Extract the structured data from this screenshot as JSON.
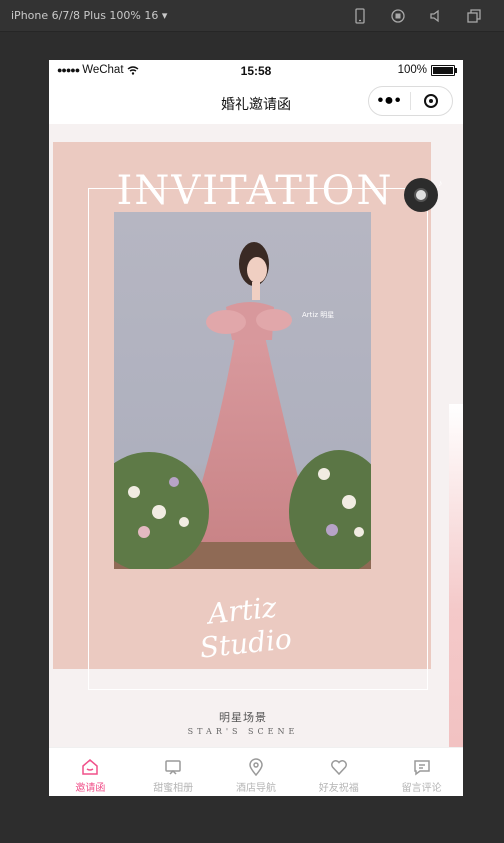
{
  "devtools": {
    "device_label": "iPhone 6/7/8 Plus 100% 16 ▾",
    "icons": [
      "phone-icon",
      "record-icon",
      "speaker-icon",
      "window-icon"
    ]
  },
  "statusbar": {
    "carrier": "WeChat",
    "time": "15:58",
    "battery": "100%"
  },
  "navbar": {
    "title": "婚礼邀请函"
  },
  "invitation": {
    "headline": "INVITATION",
    "signature": "Artiz Studio",
    "scene_cn": "明星场景",
    "scene_en": "STAR'S SCENE"
  },
  "colors": {
    "card_bg": "#ebcac1",
    "tab_active": "#f0508a",
    "tab_inactive": "#b5b5b5"
  },
  "tabs": [
    {
      "label": "邀请函",
      "icon": "home-icon",
      "active": true
    },
    {
      "label": "甜蜜相册",
      "icon": "album-icon",
      "active": false
    },
    {
      "label": "酒店导航",
      "icon": "location-icon",
      "active": false
    },
    {
      "label": "好友祝福",
      "icon": "heart-icon",
      "active": false
    },
    {
      "label": "留言评论",
      "icon": "comment-icon",
      "active": false
    }
  ]
}
